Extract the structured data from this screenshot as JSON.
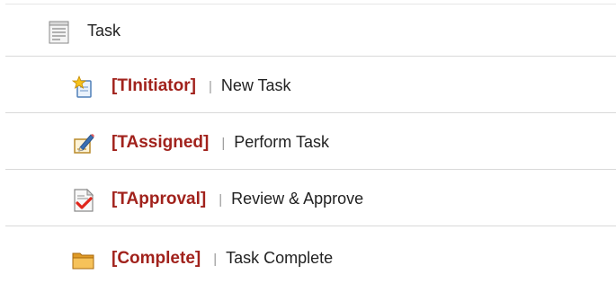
{
  "tree": {
    "root": {
      "label": "Task",
      "icon": "document-list-icon"
    },
    "items": [
      {
        "state": "[TInitiator]",
        "separator": "|",
        "description": "New Task",
        "icon": "new-task-icon"
      },
      {
        "state": "[TAssigned]",
        "separator": "|",
        "description": "Perform Task",
        "icon": "pencil-edit-icon"
      },
      {
        "state": "[TApproval]",
        "separator": "|",
        "description": "Review & Approve",
        "icon": "document-check-icon"
      },
      {
        "state": "[Complete]",
        "separator": "|",
        "description": "Task Complete",
        "icon": "folder-icon"
      }
    ]
  },
  "colors": {
    "state_text": "#a1221c",
    "body_text": "#222222",
    "separator": "#9a9a9a",
    "row_border": "#d9d9d9"
  }
}
